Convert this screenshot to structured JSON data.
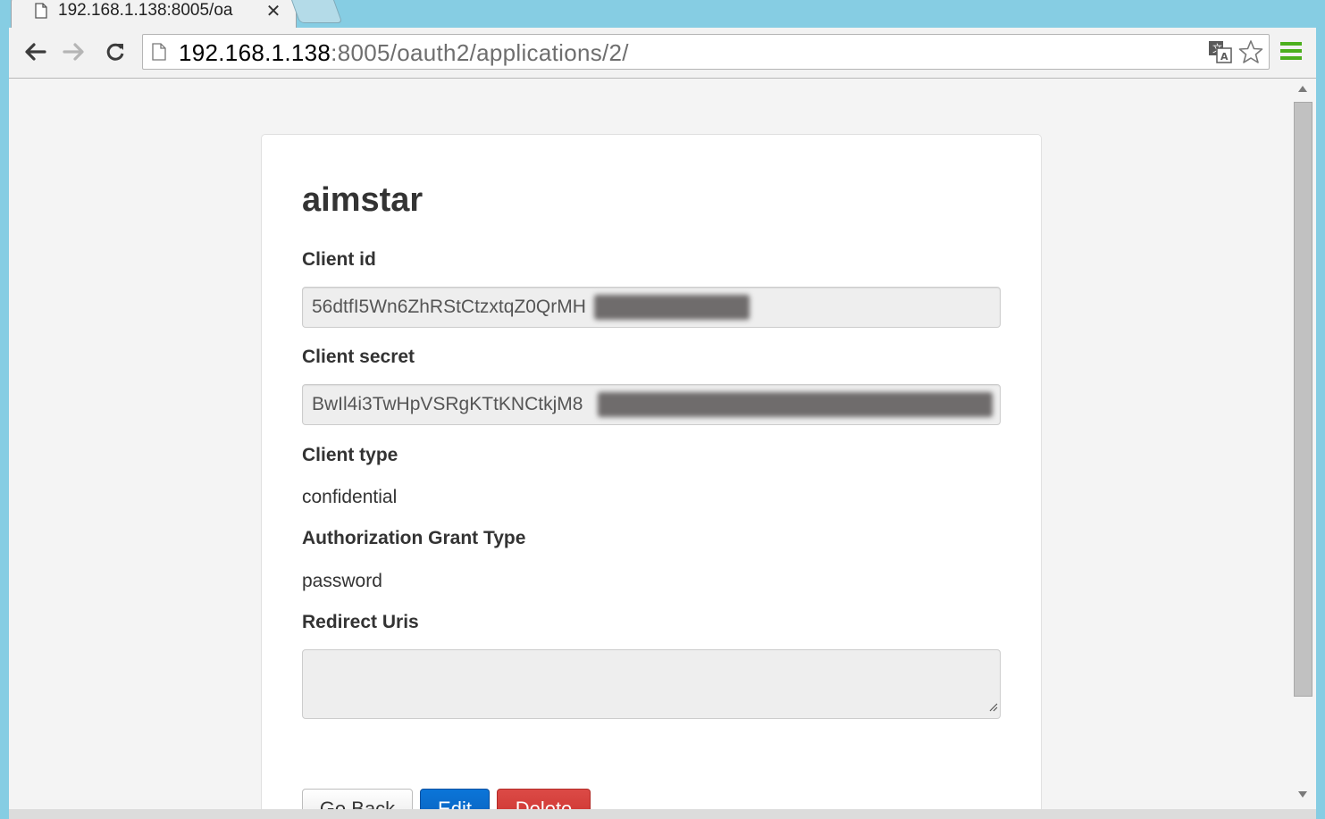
{
  "browser": {
    "tab_title": "192.168.1.138:8005/oa",
    "url_host": "192.168.1.138",
    "url_rest": ":8005/oauth2/applications/2/"
  },
  "app": {
    "name": "aimstar",
    "client_id_label": "Client id",
    "client_id_value": "56dtfI5Wn6ZhRStCtzxtqZ0QrMH",
    "client_secret_label": "Client secret",
    "client_secret_value": "BwIl4i3TwHpVSRgKTtKNCtkjM8",
    "client_type_label": "Client type",
    "client_type_value": "confidential",
    "grant_type_label": "Authorization Grant Type",
    "grant_type_value": "password",
    "redirect_uris_label": "Redirect Uris",
    "redirect_uris_value": ""
  },
  "buttons": {
    "go_back": "Go Back",
    "edit": "Edit",
    "delete": "Delete"
  },
  "colors": {
    "primary": "#0a68c8",
    "danger": "#d9534f",
    "frame": "#86cde3",
    "menu_icon": "#4caf1e"
  },
  "icons": [
    "page-icon",
    "close-icon",
    "back-arrow-icon",
    "forward-arrow-icon",
    "reload-icon",
    "translate-icon",
    "star-icon",
    "menu-icon",
    "resize-handle-icon"
  ]
}
